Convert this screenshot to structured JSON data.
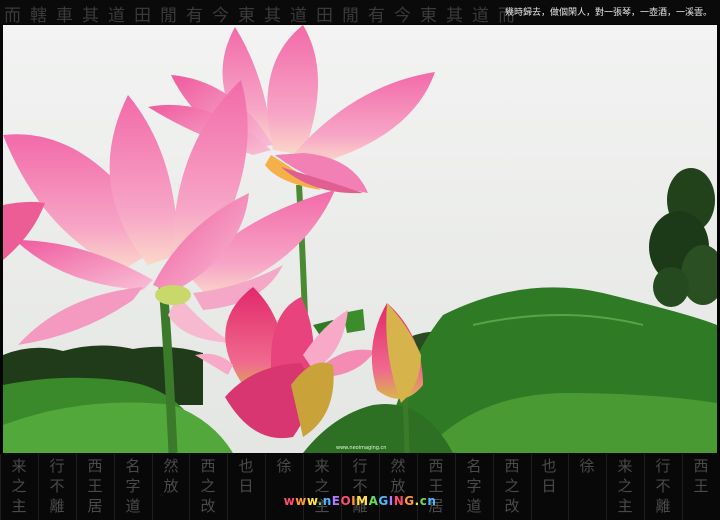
{
  "caption": "幾時歸去，做個閑人，對一張琴，一壺酒，一溪雲。",
  "top_calligraphy": "而轄車其道田閒有今東其道田閒有今東其道而",
  "bottom_calligraphy_columns": [
    "来之主",
    "行不離",
    "西王居",
    "名字道",
    "然放",
    "西之改",
    "也日",
    "徐",
    "来之主",
    "行不離",
    "然放",
    "西王居",
    "名字道",
    "西之改",
    "也日",
    "徐",
    "来之主",
    "行不離",
    "西王"
  ],
  "watermark": {
    "text": "www.nEOIMAGING.cn",
    "colors": [
      "#ff4d6d",
      "#ff9a3c",
      "#ffe14d",
      "#6ddc5a",
      "#4db8ff",
      "#b07cff"
    ]
  },
  "tiny_credit": "www.neoimaging.cn",
  "colors": {
    "sky": "#eceeed",
    "petal_pink": "#f06aa8",
    "leaf_green": "#2f7a25",
    "tree_dark": "#1f3b1a"
  },
  "icons": [
    "lotus-flower-large-icon",
    "lotus-flower-upper-icon",
    "lotus-bud-icon",
    "lotus-leaf-icon",
    "tree-icon"
  ]
}
